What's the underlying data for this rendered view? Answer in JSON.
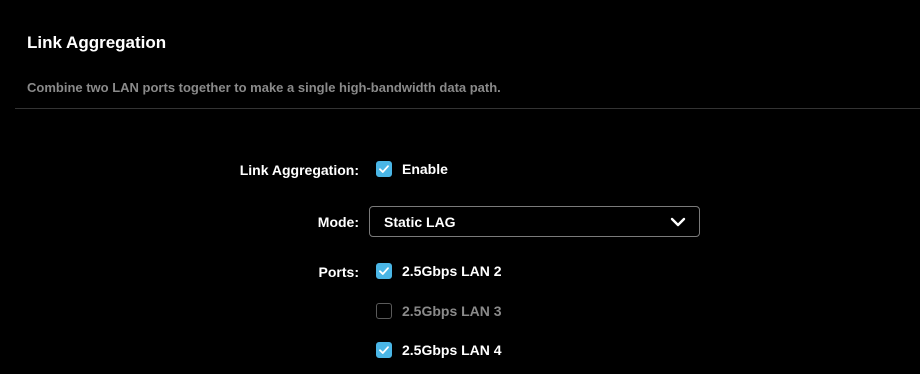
{
  "section": {
    "title": "Link Aggregation",
    "description": "Combine two LAN ports together to make a single high-bandwidth data path."
  },
  "link_aggregation": {
    "label": "Link Aggregation:",
    "enable_label": "Enable",
    "enabled": true
  },
  "mode": {
    "label": "Mode:",
    "value": "Static LAG"
  },
  "ports": {
    "label": "Ports:",
    "items": [
      {
        "label": "2.5Gbps LAN 2",
        "checked": true
      },
      {
        "label": "2.5Gbps LAN 3",
        "checked": false
      },
      {
        "label": "2.5Gbps LAN 4",
        "checked": true
      }
    ]
  },
  "colors": {
    "accent": "#4ab6e6",
    "background": "#000000",
    "text": "#ffffff",
    "muted_text": "#8a8a8a"
  },
  "icons": {
    "checkbox_checked": "check-icon",
    "select_arrow": "chevron-down-icon"
  }
}
